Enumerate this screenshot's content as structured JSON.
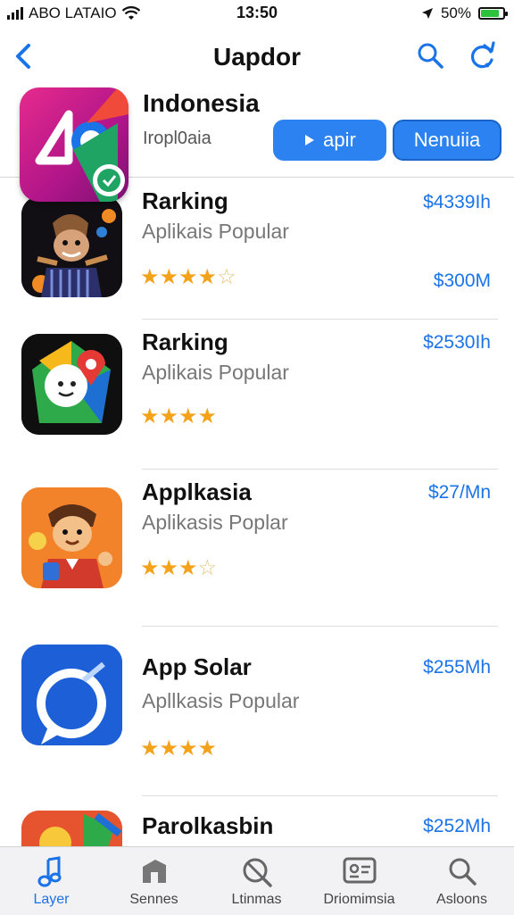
{
  "status_bar": {
    "carrier": "ABO LATAIO",
    "time": "13:50",
    "battery_pct": "50%",
    "battery_level": 0.85
  },
  "nav": {
    "title": "Uapdor",
    "back_icon": "chevron-left-icon",
    "search_icon": "search-icon",
    "refresh_icon": "refresh-icon"
  },
  "featured": {
    "title": "Indonesia",
    "subtitle": "Iropl0aia",
    "open_label": "apir",
    "menu_label": "Nenuiia"
  },
  "apps": [
    {
      "name": "Rarking",
      "subtitle": "Aplikais Popular",
      "price": "$4339Ih",
      "price2": "$300M",
      "rating": 3.5
    },
    {
      "name": "Rarking",
      "subtitle": "Aplikais Popular",
      "price": "$2530Ih",
      "price2": "",
      "rating": 4
    },
    {
      "name": "Applkasia",
      "subtitle": "Aplikasis Poplar",
      "price": "$27/Mn",
      "price2": "",
      "rating": 3.5
    },
    {
      "name": "App Solar",
      "subtitle": "Apllkasis Popular",
      "price": "$255Mh",
      "price2": "",
      "rating": 4.5
    },
    {
      "name": "Parolkasbin",
      "subtitle": "",
      "price": "$252Mh",
      "price2": "",
      "rating": 0
    }
  ],
  "tabs": [
    {
      "label": "Layer",
      "icon": "music-note-icon",
      "active": true
    },
    {
      "label": "Sennes",
      "icon": "house-icon",
      "active": false
    },
    {
      "label": "Ltinmas",
      "icon": "no-search-icon",
      "active": false
    },
    {
      "label": "Driomimsia",
      "icon": "id-card-icon",
      "active": false
    },
    {
      "label": "Asloons",
      "icon": "search-icon",
      "active": false
    }
  ],
  "colors": {
    "accent": "#1a73e8",
    "button": "#2b82f0",
    "star": "#f4a21a"
  }
}
